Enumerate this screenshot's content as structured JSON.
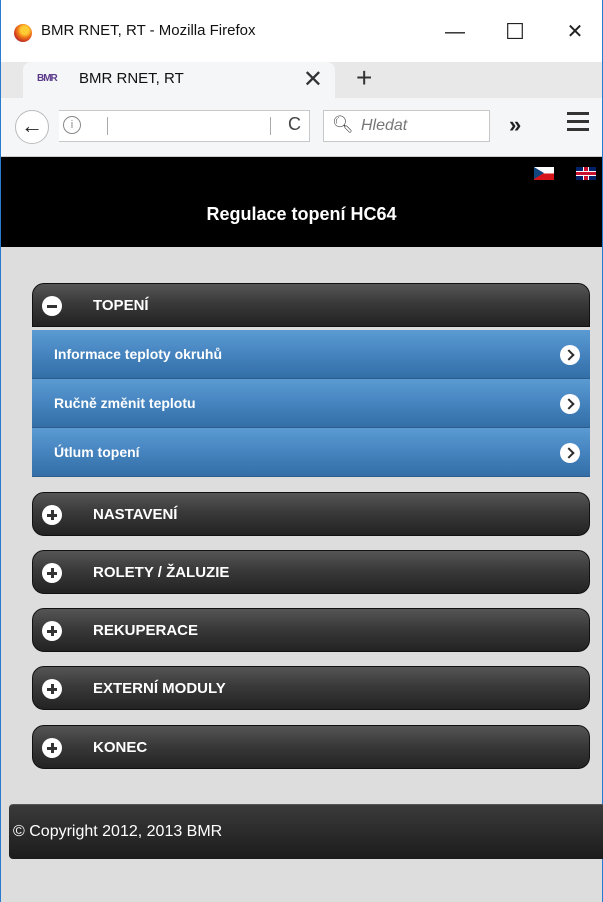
{
  "window": {
    "title": "BMR RNET, RT - Mozilla Firefox",
    "minimize": "—",
    "maximize": "☐",
    "close": "✕"
  },
  "tab": {
    "favicon_text": "BMR",
    "title": "BMR RNET, RT",
    "close": "✕",
    "new_tab": "+"
  },
  "nav": {
    "back": "←",
    "info": "i",
    "reload": "C",
    "search_placeholder": "Hledat",
    "overflow": "»"
  },
  "header": {
    "title": "Regulace topení HC64",
    "languages": [
      "cs",
      "en"
    ]
  },
  "sections": [
    {
      "label": "TOPENÍ",
      "expanded": true,
      "icon": "minus-icon"
    },
    {
      "label": "NASTAVENÍ",
      "expanded": false,
      "icon": "plus-icon"
    },
    {
      "label": "ROLETY / ŽALUZIE",
      "expanded": false,
      "icon": "plus-icon"
    },
    {
      "label": "REKUPERACE",
      "expanded": false,
      "icon": "plus-icon"
    },
    {
      "label": "EXTERNÍ MODULY",
      "expanded": false,
      "icon": "plus-icon"
    },
    {
      "label": "KONEC",
      "expanded": false,
      "icon": "plus-icon"
    }
  ],
  "topeni_items": [
    {
      "label": "Informace teploty okruhů"
    },
    {
      "label": "Ručně změnit teplotu"
    },
    {
      "label": "Útlum topení"
    }
  ],
  "footer": {
    "copyright": "© Copyright 2012, 2013 BMR"
  },
  "colors": {
    "header_bg": "#000000",
    "section_bg": "#333333",
    "subitem_bg": "#4584bf",
    "page_bg": "#dddddd"
  }
}
